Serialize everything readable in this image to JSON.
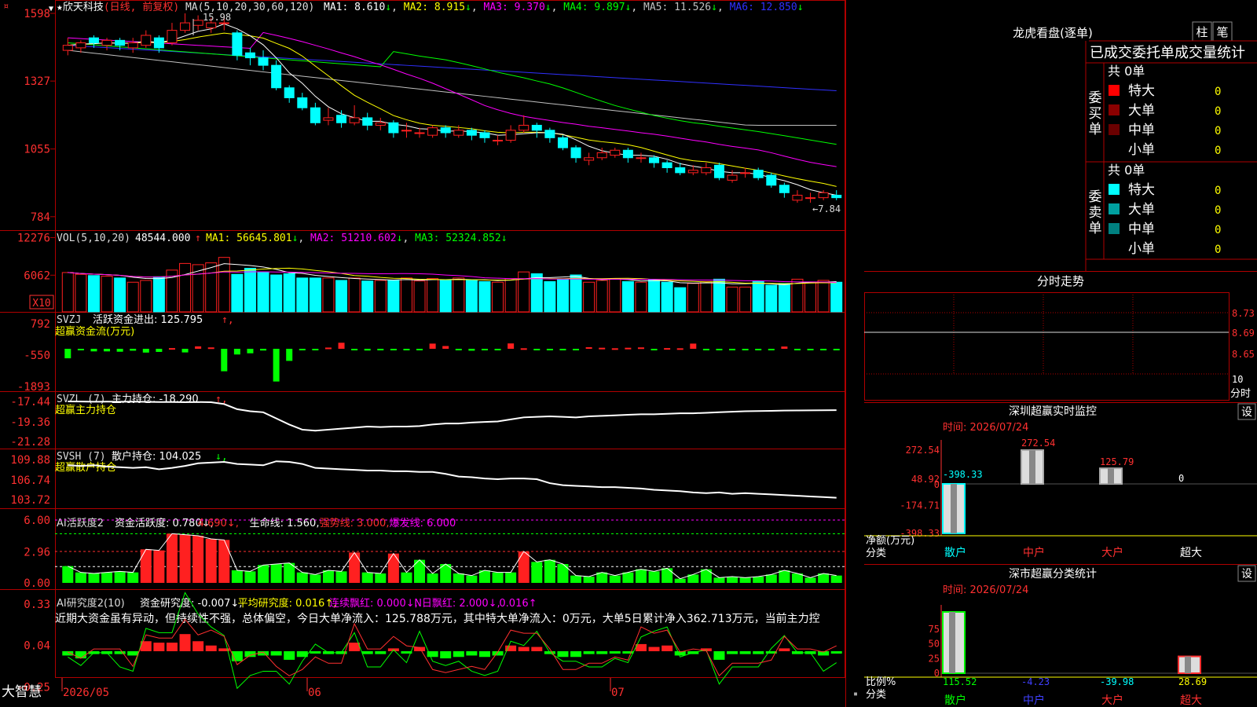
{
  "colors": {
    "up": "#ff2020",
    "down": "#00ffff",
    "vbar_up": "#ff2020",
    "ma1": "#ffffff",
    "ma2": "#ffff00",
    "ma3": "#ff00ff",
    "ma4": "#00ff00",
    "ma5": "#c0c0c0",
    "ma6": "#3030ff",
    "grid": "#b00000",
    "label": "#ff3030",
    "green": "#00ff00",
    "white": "#ffffff"
  },
  "main": {
    "menu_glyph": "¤",
    "title": "欣天科技",
    "title_star": "★",
    "title_type": "(日线, 前复权)",
    "ma_params": "MA(5,10,20,30,60,120)",
    "ma_values": [
      {
        "label": "MA1: 8.610",
        "arrow": "↓"
      },
      {
        "label": "MA2: 8.915",
        "arrow": "↓"
      },
      {
        "label": "MA3: 9.370",
        "arrow": "↓"
      },
      {
        "label": "MA4: 9.897",
        "arrow": "↓"
      },
      {
        "label": "MA5: 11.526",
        "arrow": "↓"
      },
      {
        "label": "MA6: 12.850",
        "arrow": "↓"
      }
    ],
    "price_ticks": [
      "1598",
      "1327",
      "1055",
      "784"
    ],
    "high_label": "15.98",
    "low_label": "←7.84",
    "vol_header": "VOL(5,10,20)",
    "vol_value": "48544.000",
    "vol_ma": [
      {
        "label": "MA1: 56645.801",
        "arrow": "↓"
      },
      {
        "label": "MA2: 51210.602",
        "arrow": "↓"
      },
      {
        "label": "MA3: 52324.852",
        "arrow": "↓"
      }
    ],
    "vol_ticks": [
      "12276",
      "6062"
    ],
    "vol_unit": "X10",
    "svzj_header": "SVZJ",
    "svzj_label": "活跃资金进出: 125.795",
    "svzj_sub": "超赢资金流(万元)",
    "svzj_ticks": [
      "792",
      "-550",
      "-1893"
    ],
    "svzl_header": "SVZL (7)",
    "svzl_label": "主力持仓: -18.290",
    "svzl_sub": "超赢主力持仓",
    "svzl_ticks": [
      "-17.44",
      "-19.36",
      "-21.28"
    ],
    "svsh_header": "SVSH (7)",
    "svsh_label": "散户持仓: 104.025",
    "svsh_sub": "超赢散户持仓",
    "svsh_ticks": [
      "109.88",
      "106.74",
      "103.72"
    ],
    "ai1_header": "AI活跃度2",
    "ai1_parts": [
      {
        "t": "资金活跃度: 0.780",
        "a": "↓"
      },
      {
        "t": "4.690",
        "a": "↓"
      },
      {
        "t": "生命线: 1.560",
        "a": ""
      },
      {
        "t": "强势线: 3.000",
        "a": ""
      },
      {
        "t": "爆发线: 6.000",
        "a": ""
      }
    ],
    "ai1_ticks": [
      "6.00",
      "2.96",
      "0.00"
    ],
    "ai2_header": "AI研究度2(10)",
    "ai2_parts": [
      {
        "t": "资金研究度: -0.007",
        "a": "↓"
      },
      {
        "t": "平均研究度: 0.016",
        "a": "↑"
      },
      {
        "t": "连续飘红: 0.000",
        "a": "↓"
      },
      {
        "t": "N日飘红: 2.000",
        "a": "↓"
      },
      {
        "t": "0.016",
        "a": "↑"
      }
    ],
    "ai2_text": "近期大资金虽有异动，但持续性不强，总体偏空，今日大单净流入：125.788万元，其中特大单净流入：0万元，大单5日累计净入362.713万元，当前主力控",
    "ai2_ticks": [
      "0.33",
      "0.04",
      "-0.25"
    ],
    "brand": "大智慧",
    "dates": [
      "2026/05",
      "06",
      "07"
    ]
  },
  "side": {
    "lhb_title": "龙虎看盘(逐单)",
    "btn_zhu": "柱",
    "btn_bi": "笔",
    "tab_text": "已成交委托单成交量统计",
    "buy_label": "委买单",
    "sell_label": "委卖单",
    "buy_total": "共 0单",
    "sell_total": "共 0单",
    "buy_rows": [
      {
        "name": "特大",
        "val": "0",
        "color": "#ff0000"
      },
      {
        "name": "大单",
        "val": "0",
        "color": "#8b0000"
      },
      {
        "name": "中单",
        "val": "0",
        "color": "#6a0000"
      },
      {
        "name": "小单",
        "val": "0",
        "color": "#000000"
      }
    ],
    "sell_rows": [
      {
        "name": "特大",
        "val": "0",
        "color": "#00ffff"
      },
      {
        "name": "大单",
        "val": "0",
        "color": "#00a0a0"
      },
      {
        "name": "中单",
        "val": "0",
        "color": "#008080"
      },
      {
        "name": "小单",
        "val": "0",
        "color": "#000000"
      }
    ],
    "fs_title": "分时走势",
    "fs_ticks": [
      "8.73",
      "8.69",
      "8.65"
    ],
    "fs_vol": "10",
    "fs_unit": "分时",
    "sz_title": "深圳超赢实时监控",
    "sz_set": "设",
    "sz_time": "时间: 2026/07/24",
    "sz_ticks": [
      "272.54",
      "48.92",
      "0",
      "-174.71",
      "-398.33"
    ],
    "sz_vals": [
      "-398.33",
      "272.54",
      "125.79",
      "0"
    ],
    "sz_unit": "净额(万元)",
    "sz_cat": "分类",
    "cats": [
      "散户",
      "中户",
      "大户",
      "超大"
    ],
    "ss_title": "深市超赢分类统计",
    "ss_set": "设",
    "ss_time": "时间: 2026/07/24",
    "ss_ticks": [
      "75",
      "50",
      "25",
      "0"
    ],
    "ss_vals": [
      "115.52",
      "-4.23",
      "-39.98",
      "28.69"
    ],
    "ss_unit": "比例%",
    "ss_cat": "分类"
  },
  "chart_data": {
    "type": "bar",
    "title": "欣天科技",
    "candles": [
      {
        "o": 14.5,
        "c": 14.7,
        "h": 15.0,
        "l": 14.3
      },
      {
        "o": 14.6,
        "c": 14.8,
        "h": 14.9,
        "l": 14.4
      },
      {
        "o": 15.0,
        "c": 14.8,
        "h": 15.1,
        "l": 14.6
      },
      {
        "o": 14.7,
        "c": 14.9,
        "h": 15.0,
        "l": 14.5
      },
      {
        "o": 14.9,
        "c": 14.7,
        "h": 15.0,
        "l": 14.5
      },
      {
        "o": 14.6,
        "c": 14.8,
        "h": 15.0,
        "l": 14.4
      },
      {
        "o": 14.7,
        "c": 15.1,
        "h": 15.3,
        "l": 14.6
      },
      {
        "o": 15.0,
        "c": 14.6,
        "h": 15.1,
        "l": 14.4
      },
      {
        "o": 14.8,
        "c": 15.3,
        "h": 15.6,
        "l": 14.7
      },
      {
        "o": 15.3,
        "c": 15.6,
        "h": 15.98,
        "l": 15.2
      },
      {
        "o": 15.5,
        "c": 15.7,
        "h": 15.9,
        "l": 15.3
      },
      {
        "o": 15.4,
        "c": 15.6,
        "h": 15.8,
        "l": 15.2
      },
      {
        "o": 15.6,
        "c": 15.6,
        "h": 15.9,
        "l": 15.3
      },
      {
        "o": 15.2,
        "c": 14.3,
        "h": 15.3,
        "l": 14.1
      },
      {
        "o": 14.4,
        "c": 14.2,
        "h": 14.6,
        "l": 13.9
      },
      {
        "o": 14.2,
        "c": 13.9,
        "h": 14.5,
        "l": 13.7
      },
      {
        "o": 13.9,
        "c": 13.0,
        "h": 14.1,
        "l": 12.9
      },
      {
        "o": 13.0,
        "c": 12.6,
        "h": 13.1,
        "l": 12.4
      },
      {
        "o": 12.6,
        "c": 12.2,
        "h": 12.8,
        "l": 12.1
      },
      {
        "o": 12.2,
        "c": 11.6,
        "h": 12.4,
        "l": 11.5
      },
      {
        "o": 11.7,
        "c": 11.8,
        "h": 12.2,
        "l": 11.5
      },
      {
        "o": 11.9,
        "c": 11.6,
        "h": 12.1,
        "l": 11.4
      },
      {
        "o": 11.6,
        "c": 11.8,
        "h": 12.3,
        "l": 11.5
      },
      {
        "o": 11.8,
        "c": 11.5,
        "h": 12.0,
        "l": 11.3
      },
      {
        "o": 11.5,
        "c": 11.6,
        "h": 11.8,
        "l": 11.3
      },
      {
        "o": 11.6,
        "c": 11.2,
        "h": 11.7,
        "l": 11.0
      },
      {
        "o": 11.3,
        "c": 11.3,
        "h": 11.6,
        "l": 11.0
      },
      {
        "o": 11.2,
        "c": 11.2,
        "h": 11.4,
        "l": 11.0
      },
      {
        "o": 11.1,
        "c": 11.4,
        "h": 11.5,
        "l": 11.0
      },
      {
        "o": 11.4,
        "c": 11.2,
        "h": 11.5,
        "l": 11.0
      },
      {
        "o": 11.1,
        "c": 11.3,
        "h": 11.5,
        "l": 11.0
      },
      {
        "o": 11.3,
        "c": 11.1,
        "h": 11.4,
        "l": 10.9
      },
      {
        "o": 11.2,
        "c": 11.0,
        "h": 11.3,
        "l": 10.8
      },
      {
        "o": 10.9,
        "c": 10.9,
        "h": 11.1,
        "l": 10.7
      },
      {
        "o": 10.9,
        "c": 11.3,
        "h": 11.5,
        "l": 10.8
      },
      {
        "o": 11.3,
        "c": 11.5,
        "h": 11.9,
        "l": 11.2
      },
      {
        "o": 11.5,
        "c": 11.3,
        "h": 11.6,
        "l": 11.0
      },
      {
        "o": 11.3,
        "c": 11.0,
        "h": 11.4,
        "l": 10.8
      },
      {
        "o": 11.0,
        "c": 10.6,
        "h": 11.1,
        "l": 10.5
      },
      {
        "o": 10.6,
        "c": 10.2,
        "h": 10.7,
        "l": 10.0
      },
      {
        "o": 10.1,
        "c": 10.2,
        "h": 10.4,
        "l": 9.9
      },
      {
        "o": 10.2,
        "c": 10.4,
        "h": 10.6,
        "l": 10.1
      },
      {
        "o": 10.3,
        "c": 10.5,
        "h": 10.6,
        "l": 10.2
      },
      {
        "o": 10.5,
        "c": 10.2,
        "h": 10.6,
        "l": 10.0
      },
      {
        "o": 10.2,
        "c": 10.2,
        "h": 10.4,
        "l": 10.0
      },
      {
        "o": 10.2,
        "c": 10.0,
        "h": 10.3,
        "l": 9.8
      },
      {
        "o": 10.0,
        "c": 9.8,
        "h": 10.1,
        "l": 9.6
      },
      {
        "o": 9.8,
        "c": 9.6,
        "h": 10.0,
        "l": 9.5
      },
      {
        "o": 9.6,
        "c": 9.7,
        "h": 9.9,
        "l": 9.5
      },
      {
        "o": 9.6,
        "c": 9.8,
        "h": 10.0,
        "l": 9.5
      },
      {
        "o": 9.9,
        "c": 9.4,
        "h": 10.0,
        "l": 9.3
      },
      {
        "o": 9.3,
        "c": 9.5,
        "h": 9.7,
        "l": 9.2
      },
      {
        "o": 9.6,
        "c": 9.6,
        "h": 9.8,
        "l": 9.4
      },
      {
        "o": 9.7,
        "c": 9.4,
        "h": 9.8,
        "l": 9.3
      },
      {
        "o": 9.5,
        "c": 9.1,
        "h": 9.6,
        "l": 9.0
      },
      {
        "o": 9.1,
        "c": 8.8,
        "h": 9.2,
        "l": 8.6
      },
      {
        "o": 8.5,
        "c": 8.7,
        "h": 8.9,
        "l": 8.4
      },
      {
        "o": 8.6,
        "c": 8.6,
        "h": 8.8,
        "l": 8.4
      },
      {
        "o": 8.6,
        "c": 8.8,
        "h": 8.9,
        "l": 8.5
      },
      {
        "o": 8.7,
        "c": 8.6,
        "h": 8.9,
        "l": 8.5
      }
    ],
    "volume": [
      6500,
      6200,
      6000,
      5900,
      5600,
      4900,
      5200,
      5800,
      6900,
      8000,
      7800,
      8100,
      9000,
      6200,
      7200,
      6600,
      6100,
      6300,
      5600,
      5600,
      5600,
      5200,
      5600,
      5100,
      5200,
      5200,
      5600,
      5100,
      5500,
      5200,
      5600,
      5200,
      5000,
      4900,
      5500,
      6600,
      6300,
      5000,
      5400,
      6100,
      4900,
      5200,
      5500,
      5000,
      4900,
      5300,
      4900,
      4000,
      4700,
      5000,
      5400,
      4100,
      4100,
      5100,
      4400,
      4700,
      5400,
      4800,
      5200,
      4900
    ],
    "svzj": [
      -550,
      -60,
      -150,
      -150,
      -170,
      -110,
      -220,
      -180,
      40,
      -210,
      140,
      80,
      -1300,
      -330,
      -260,
      -100,
      -1893,
      -700,
      -30,
      -10,
      70,
      350,
      -70,
      -100,
      -10,
      -50,
      -10,
      -10,
      300,
      160,
      -80,
      -110,
      -80,
      -70,
      310,
      30,
      -10,
      -70,
      -80,
      -70,
      90,
      60,
      30,
      60,
      80,
      0,
      40,
      30,
      300,
      -20,
      -20,
      -20,
      -50,
      -30,
      -20,
      130,
      -20,
      -20,
      -40,
      -30
    ],
    "svzl": [
      -17.44,
      -17.45,
      -17.47,
      -17.46,
      -17.47,
      -17.46,
      -17.48,
      -17.5,
      -17.5,
      -17.52,
      -17.5,
      -17.52,
      -17.7,
      -18.2,
      -18.4,
      -18.5,
      -19.1,
      -19.7,
      -20.2,
      -20.3,
      -20.2,
      -20.1,
      -20.0,
      -19.9,
      -19.95,
      -19.9,
      -19.9,
      -19.85,
      -19.7,
      -19.6,
      -19.6,
      -19.5,
      -19.45,
      -19.4,
      -19.2,
      -19.0,
      -18.95,
      -18.9,
      -18.95,
      -19.0,
      -18.9,
      -18.85,
      -18.8,
      -18.75,
      -18.7,
      -18.7,
      -18.65,
      -18.6,
      -18.6,
      -18.55,
      -18.5,
      -18.45,
      -18.4,
      -18.38,
      -18.36,
      -18.33,
      -18.32,
      -18.31,
      -18.3,
      -18.29
    ],
    "svsh": [
      108.9,
      108.8,
      108.9,
      108.7,
      108.6,
      108.5,
      108.6,
      108.3,
      108.5,
      108.8,
      109.2,
      109.3,
      109.4,
      109.1,
      109.0,
      108.9,
      109.5,
      109.4,
      109.1,
      108.5,
      108.4,
      108.3,
      108.2,
      108.1,
      108.1,
      108.0,
      108.0,
      107.9,
      107.9,
      107.6,
      107.2,
      107.1,
      106.9,
      106.8,
      106.9,
      106.9,
      106.8,
      106.2,
      105.9,
      105.8,
      105.7,
      105.6,
      105.6,
      105.5,
      105.4,
      105.2,
      105.1,
      105.0,
      104.8,
      104.7,
      104.8,
      104.6,
      104.7,
      104.6,
      104.5,
      104.4,
      104.3,
      104.2,
      104.1,
      104.0
    ],
    "ai1": [
      1.6,
      1.0,
      0.9,
      1.0,
      1.1,
      1.0,
      3.2,
      3.1,
      4.7,
      4.6,
      4.5,
      4.2,
      4.1,
      1.2,
      1.1,
      1.7,
      1.8,
      1.9,
      1.0,
      0.8,
      1.2,
      1.1,
      2.9,
      1.0,
      0.9,
      2.8,
      1.0,
      2.2,
      0.9,
      1.8,
      0.9,
      0.7,
      1.2,
      1.0,
      1.0,
      3.0,
      2.0,
      2.2,
      1.8,
      0.7,
      0.6,
      1.0,
      0.7,
      1.0,
      1.3,
      1.1,
      1.4,
      0.4,
      0.8,
      1.3,
      0.5,
      0.6,
      0.5,
      0.6,
      0.8,
      1.2,
      0.9,
      0.5,
      0.9,
      0.7
    ],
    "ai2": [
      -0.03,
      -0.05,
      -0.02,
      -0.02,
      -0.02,
      -0.03,
      0.07,
      0.06,
      0.06,
      0.12,
      0.07,
      0.04,
      0.02,
      -0.07,
      -0.04,
      -0.03,
      -0.03,
      -0.06,
      -0.04,
      0.0,
      -0.02,
      -0.02,
      0.06,
      -0.02,
      -0.02,
      0.02,
      -0.01,
      0.03,
      -0.04,
      -0.05,
      -0.04,
      -0.03,
      -0.04,
      -0.03,
      0.04,
      0.03,
      0.03,
      -0.02,
      -0.04,
      -0.04,
      -0.02,
      -0.02,
      0.0,
      -0.01,
      0.05,
      0.03,
      0.04,
      -0.03,
      -0.02,
      0.02,
      -0.06,
      -0.02,
      -0.02,
      -0.02,
      -0.01,
      0.02,
      -0.02,
      -0.02,
      -0.03,
      -0.01
    ]
  }
}
